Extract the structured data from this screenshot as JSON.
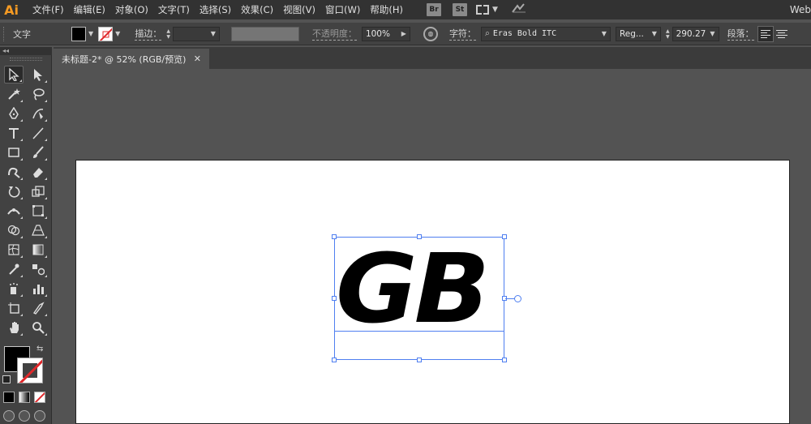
{
  "app": {
    "logo": "Ai",
    "workspace_label": "Web"
  },
  "menu": [
    "文件(F)",
    "编辑(E)",
    "对象(O)",
    "文字(T)",
    "选择(S)",
    "效果(C)",
    "视图(V)",
    "窗口(W)",
    "帮助(H)"
  ],
  "bridge": {
    "br": "Br",
    "st": "St"
  },
  "control": {
    "context_label": "文字",
    "stroke_label": "描边：",
    "opacity_label": "不透明度：",
    "opacity_value": "100%",
    "character_label": "字符：",
    "font_family": "Eras Bold ITC",
    "font_style": "Reg...",
    "font_size": "290.27",
    "paragraph_label": "段落："
  },
  "panel_collapse": "◂◂",
  "document": {
    "tab_title": "未标题-2* @ 52% (RGB/预览)",
    "close": "✕"
  },
  "artwork": {
    "text": "GB"
  },
  "colors": {
    "selection": "#4f7ff0",
    "fill": "#000000",
    "canvas_bg": "#535353",
    "artboard": "#ffffff"
  },
  "tools": [
    [
      "selection-tool",
      "direct-selection-tool"
    ],
    [
      "magic-wand-tool",
      "lasso-tool"
    ],
    [
      "pen-tool",
      "curvature-tool"
    ],
    [
      "type-tool",
      "line-segment-tool"
    ],
    [
      "rectangle-tool",
      "paintbrush-tool"
    ],
    [
      "shaper-tool",
      "eraser-tool"
    ],
    [
      "rotate-tool",
      "scale-tool"
    ],
    [
      "width-tool",
      "free-transform-tool"
    ],
    [
      "shape-builder-tool",
      "perspective-grid-tool"
    ],
    [
      "mesh-tool",
      "gradient-tool"
    ],
    [
      "eyedropper-tool",
      "blend-tool"
    ],
    [
      "symbol-sprayer-tool",
      "column-graph-tool"
    ],
    [
      "artboard-tool",
      "slice-tool"
    ],
    [
      "hand-tool",
      "zoom-tool"
    ]
  ]
}
